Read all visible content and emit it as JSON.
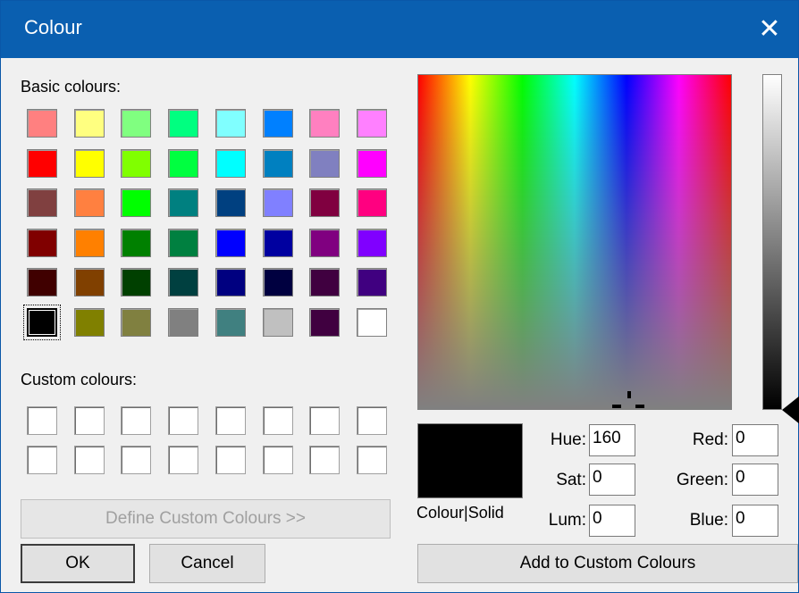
{
  "window": {
    "title": "Colour",
    "close_label": "✕"
  },
  "basic": {
    "label": "Basic colours:",
    "colors": [
      [
        "#ff8080",
        "#ffff80",
        "#80ff80",
        "#00ff80",
        "#80ffff",
        "#0080ff",
        "#ff80c0",
        "#ff80ff"
      ],
      [
        "#ff0000",
        "#ffff00",
        "#80ff00",
        "#00ff40",
        "#00ffff",
        "#0080c0",
        "#8080c0",
        "#ff00ff"
      ],
      [
        "#804040",
        "#ff8040",
        "#00ff00",
        "#008080",
        "#004080",
        "#8080ff",
        "#800040",
        "#ff0080"
      ],
      [
        "#800000",
        "#ff8000",
        "#008000",
        "#008040",
        "#0000ff",
        "#0000a0",
        "#800080",
        "#8000ff"
      ],
      [
        "#400000",
        "#804000",
        "#004000",
        "#004040",
        "#000080",
        "#000040",
        "#400040",
        "#400080"
      ],
      [
        "#000000",
        "#808000",
        "#808040",
        "#808080",
        "#408080",
        "#c0c0c0",
        "#400040",
        "#ffffff"
      ]
    ],
    "selected_row": 5,
    "selected_col": 0
  },
  "custom": {
    "label": "Custom colours:"
  },
  "buttons": {
    "define": "Define Custom Colours >>",
    "ok": "OK",
    "cancel": "Cancel",
    "add": "Add to Custom Colours"
  },
  "preview": {
    "label": "Colour|Solid",
    "color": "#000000"
  },
  "fields": {
    "hue": {
      "label": "Hue:",
      "value": "160"
    },
    "sat": {
      "label": "Sat:",
      "value": "0"
    },
    "lum": {
      "label": "Lum:",
      "value": "0"
    },
    "red": {
      "label": "Red:",
      "value": "0"
    },
    "green": {
      "label": "Green:",
      "value": "0"
    },
    "blue": {
      "label": "Blue:",
      "value": "0"
    }
  }
}
